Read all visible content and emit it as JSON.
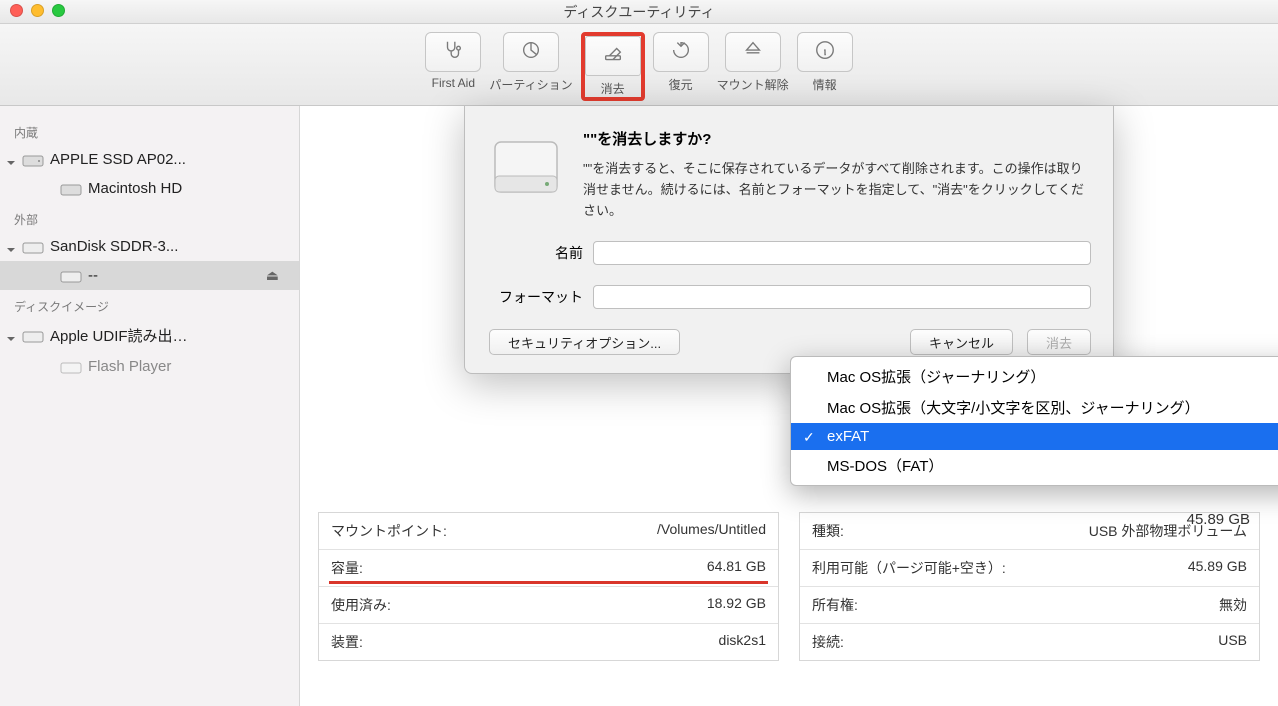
{
  "window": {
    "title": "ディスクユーティリティ"
  },
  "toolbar": {
    "items": [
      {
        "label": "First Aid"
      },
      {
        "label": "パーティション"
      },
      {
        "label": "消去"
      },
      {
        "label": "復元"
      },
      {
        "label": "マウント解除"
      },
      {
        "label": "情報"
      }
    ]
  },
  "sidebar": {
    "sections": {
      "internal": "内蔵",
      "external": "外部",
      "diskimage": "ディスクイメージ"
    },
    "internal_items": [
      {
        "label": "APPLE SSD AP02..."
      },
      {
        "label": "Macintosh HD"
      }
    ],
    "external_items": [
      {
        "label": "SanDisk SDDR-3..."
      },
      {
        "label": "--"
      }
    ],
    "diskimage_items": [
      {
        "label": "Apple UDIF読み出…"
      },
      {
        "label": "Flash Player"
      }
    ]
  },
  "sheet": {
    "title": "\"\"を消去しますか?",
    "desc": "\"\"を消去すると、そこに保存されているデータがすべて削除されます。この操作は取り消せません。続けるには、名前とフォーマットを指定して、\"消去\"をクリックしてください。",
    "name_label": "名前",
    "format_label": "フォーマット",
    "buttons": {
      "security": "セキュリティオプション...",
      "cancel": "キャンセル",
      "erase": "消去"
    }
  },
  "dropdown": {
    "items": [
      "Mac OS拡張（ジャーナリング）",
      "Mac OS拡張（大文字/小文字を区別、ジャーナリング）",
      "exFAT",
      "MS-DOS（FAT）"
    ],
    "selected_index": 2
  },
  "background": {
    "free_value": "45.89 GB"
  },
  "details": {
    "left": [
      {
        "label": "マウントポイント:",
        "value": "/Volumes/Untitled"
      },
      {
        "label": "容量:",
        "value": "64.81 GB",
        "underline": true
      },
      {
        "label": "使用済み:",
        "value": "18.92 GB"
      },
      {
        "label": "装置:",
        "value": "disk2s1"
      }
    ],
    "right": [
      {
        "label": "種類:",
        "value": "USB 外部物理ボリューム"
      },
      {
        "label": "利用可能（パージ可能+空き）:",
        "value": "45.89 GB"
      },
      {
        "label": "所有権:",
        "value": "無効"
      },
      {
        "label": "接続:",
        "value": "USB"
      }
    ]
  }
}
